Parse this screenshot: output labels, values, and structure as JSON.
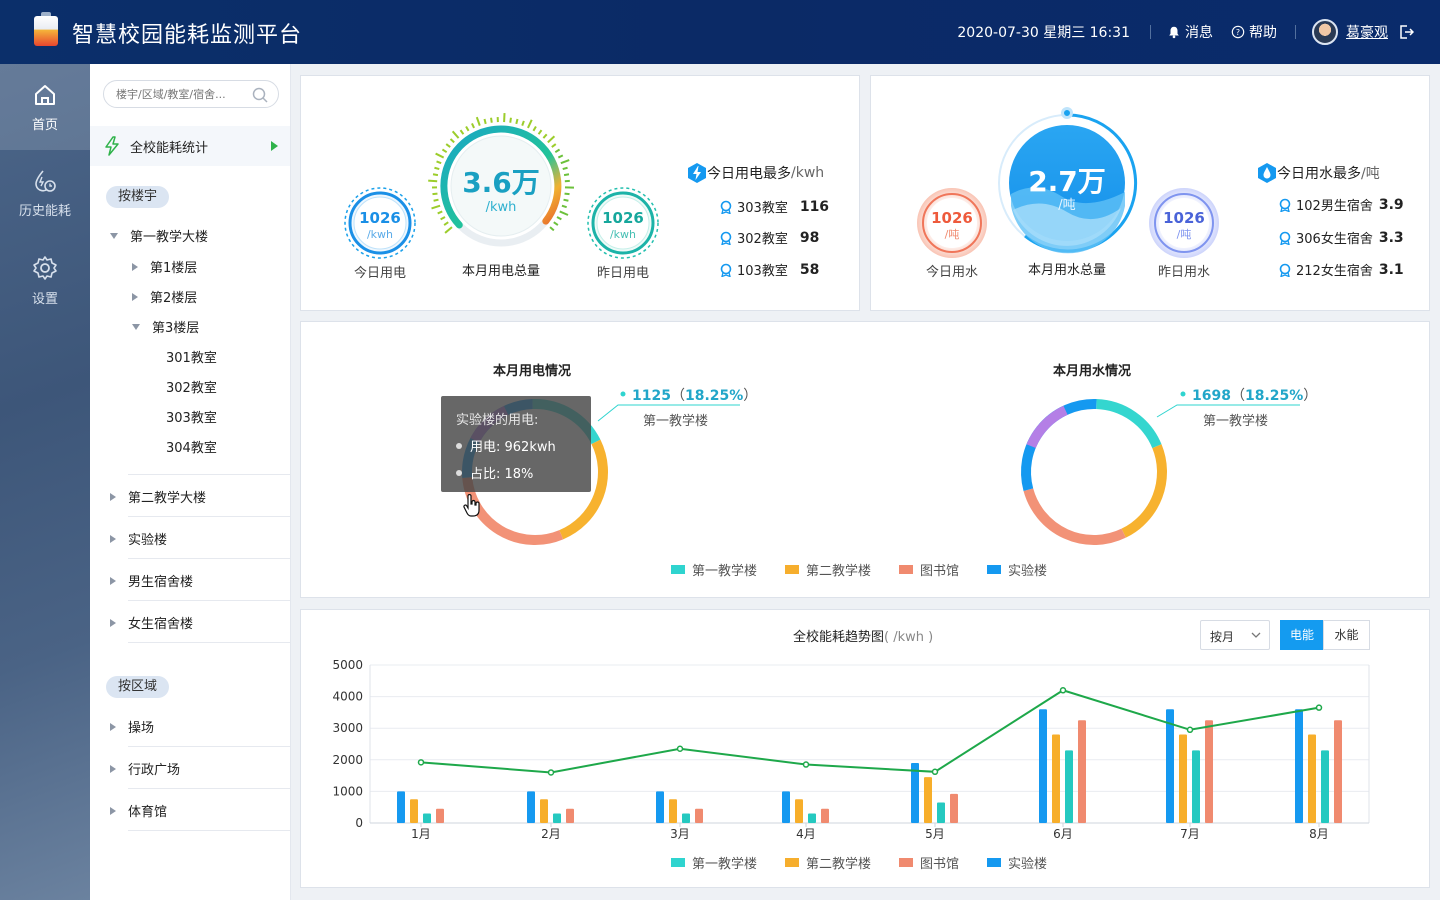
{
  "header": {
    "title": "智慧校园能耗监测平台",
    "datetime": "2020-07-30 星期三 16:31",
    "messages_label": "消息",
    "help_label": "帮助",
    "user_name": "葛豪观"
  },
  "nav": {
    "home": "首页",
    "history": "历史能耗",
    "settings": "设置"
  },
  "tree": {
    "search_placeholder": "楼宇/区域/教室/宿舍...",
    "top_item": "全校能耗统计",
    "by_building": "按楼宇",
    "by_area": "按区域",
    "b1": "第一教学大楼",
    "f1": "第1楼层",
    "f2": "第2楼层",
    "f3": "第3楼层",
    "r301": "301教室",
    "r302": "302教室",
    "r303": "303教室",
    "r304": "304教室",
    "b2": "第二教学大楼",
    "b3": "实验楼",
    "b4": "男生宿舍楼",
    "b5": "女生宿舍楼",
    "a1": "操场",
    "a2": "行政广场",
    "a3": "体育馆"
  },
  "electric": {
    "today_value": "1026",
    "today_unit": "/kwh",
    "today_label": "今日用电",
    "month_value": "3.6万",
    "month_unit": "/kwh",
    "month_label": "本月用电总量",
    "yesterday_value": "1026",
    "yesterday_unit": "/kwh",
    "yesterday_label": "昨日用电",
    "rank_title": "今日用电最多",
    "rank_unit": "/kwh",
    "rank": [
      {
        "name": "303教室",
        "value": "116"
      },
      {
        "name": "302教室",
        "value": "98"
      },
      {
        "name": "103教室",
        "value": "58"
      }
    ]
  },
  "water": {
    "today_value": "1026",
    "today_unit": "/吨",
    "today_label": "今日用水",
    "month_value": "2.7万",
    "month_unit": "/吨",
    "month_label": "本月用水总量",
    "yesterday_value": "1026",
    "yesterday_unit": "/吨",
    "yesterday_label": "昨日用水",
    "rank_title": "今日用水最多",
    "rank_unit": "/吨",
    "rank": [
      {
        "name": "102男生宿舍",
        "value": "3.9"
      },
      {
        "name": "306女生宿舍",
        "value": "3.3"
      },
      {
        "name": "212女生宿舍",
        "value": "3.1"
      }
    ]
  },
  "donuts": {
    "electric_title": "本月用电情况",
    "electric_callout_value": "1125",
    "electric_callout_pct": "18.25%",
    "electric_callout_name": "第一教学楼",
    "water_title": "本月用水情况",
    "water_callout_value": "1698",
    "water_callout_pct": "18.25%",
    "water_callout_name": "第一教学楼",
    "tooltip_title": "实验楼的用电:",
    "tooltip_usage": "用电: 962kwh",
    "tooltip_ratio": "占比: 18%"
  },
  "legend": [
    {
      "name": "第一教学楼",
      "color": "#2fd4cf"
    },
    {
      "name": "第二教学楼",
      "color": "#f6ae2d"
    },
    {
      "name": "图书馆",
      "color": "#f08a6f"
    },
    {
      "name": "实验楼",
      "color": "#1599f0"
    }
  ],
  "trend": {
    "title": "全校能耗趋势图",
    "unit": "( /kwh )",
    "period": "按月",
    "tab_electric": "电能",
    "tab_water": "水能"
  },
  "chart_data": [
    {
      "type": "pie",
      "title": "本月用电情况",
      "categories": [
        "第一教学楼",
        "第二教学楼",
        "图书馆",
        "实验楼"
      ],
      "values": [
        18.25,
        26,
        30,
        25.75
      ],
      "annotations": [
        "1125（18.25%）第一教学楼"
      ]
    },
    {
      "type": "pie",
      "title": "本月用水情况",
      "categories": [
        "第一教学楼",
        "第二教学楼",
        "图书馆",
        "实验楼"
      ],
      "values": [
        18.25,
        24,
        28,
        29.75
      ],
      "annotations": [
        "1698（18.25%）第一教学楼"
      ]
    },
    {
      "type": "bar",
      "title": "全校能耗趋势图",
      "categories": [
        "1月",
        "2月",
        "3月",
        "4月",
        "5月",
        "6月",
        "7月",
        "8月"
      ],
      "yticks": [
        0,
        1000,
        2000,
        3000,
        4000,
        5000
      ],
      "ylim": [
        0,
        5000
      ],
      "grid": true,
      "series": [
        {
          "name": "实验楼",
          "values": [
            1000,
            1000,
            1000,
            1000,
            1900,
            3600,
            3600,
            3600
          ]
        },
        {
          "name": "第二教学楼",
          "values": [
            750,
            750,
            750,
            750,
            1450,
            2800,
            2800,
            2800
          ]
        },
        {
          "name": "第一教学楼",
          "values": [
            300,
            300,
            300,
            300,
            650,
            2300,
            2300,
            2300
          ]
        },
        {
          "name": "图书馆",
          "values": [
            450,
            450,
            450,
            450,
            920,
            3250,
            3250,
            3250
          ]
        }
      ],
      "line": {
        "values": [
          1920,
          1600,
          2350,
          1850,
          1620,
          4200,
          2950,
          3650
        ]
      }
    }
  ]
}
